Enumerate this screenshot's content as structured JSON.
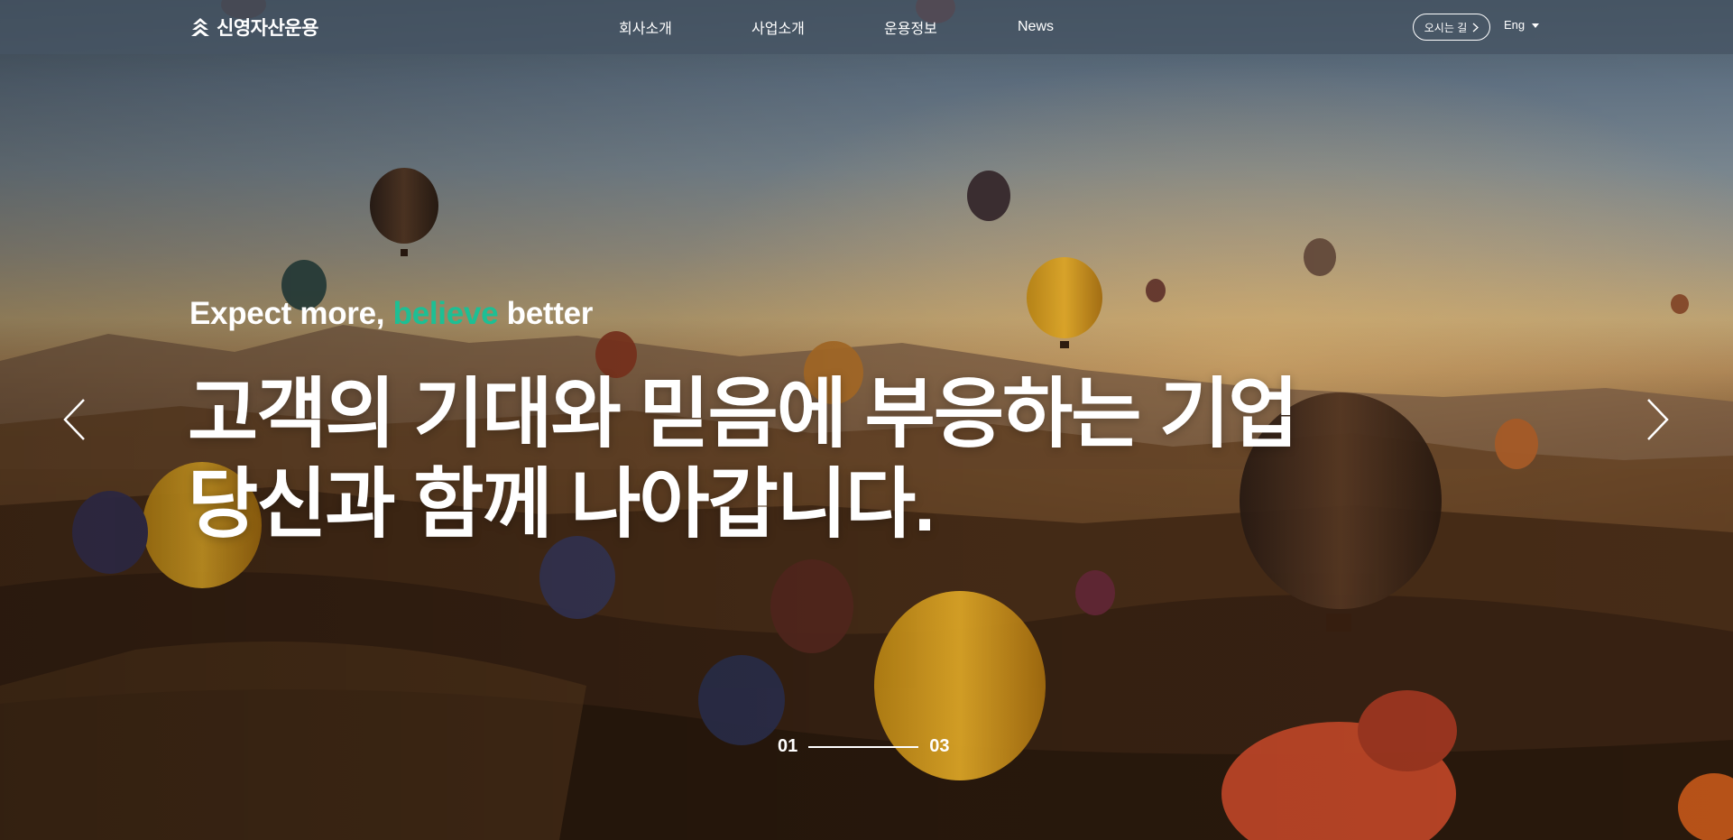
{
  "brand": {
    "name": "신영자산운용"
  },
  "nav": {
    "items": [
      "회사소개",
      "사업소개",
      "운용정보",
      "News"
    ]
  },
  "header": {
    "directions_label": "오시는 길",
    "language_label": "Eng"
  },
  "hero": {
    "tagline_start": "Expect more, ",
    "tagline_accent": "believe",
    "tagline_end": " better",
    "headline_line1": "고객의 기대와 믿음에 부응하는 기업",
    "headline_line2": "당신과 함께 나아갑니다."
  },
  "pager": {
    "current": "01",
    "total": "03"
  },
  "colors": {
    "accent": "#1dbf94",
    "header_bg": "#46546480"
  },
  "icons": {
    "prev": "chevron-left-icon",
    "next": "chevron-right-icon",
    "logo": "logo-mark-icon"
  }
}
